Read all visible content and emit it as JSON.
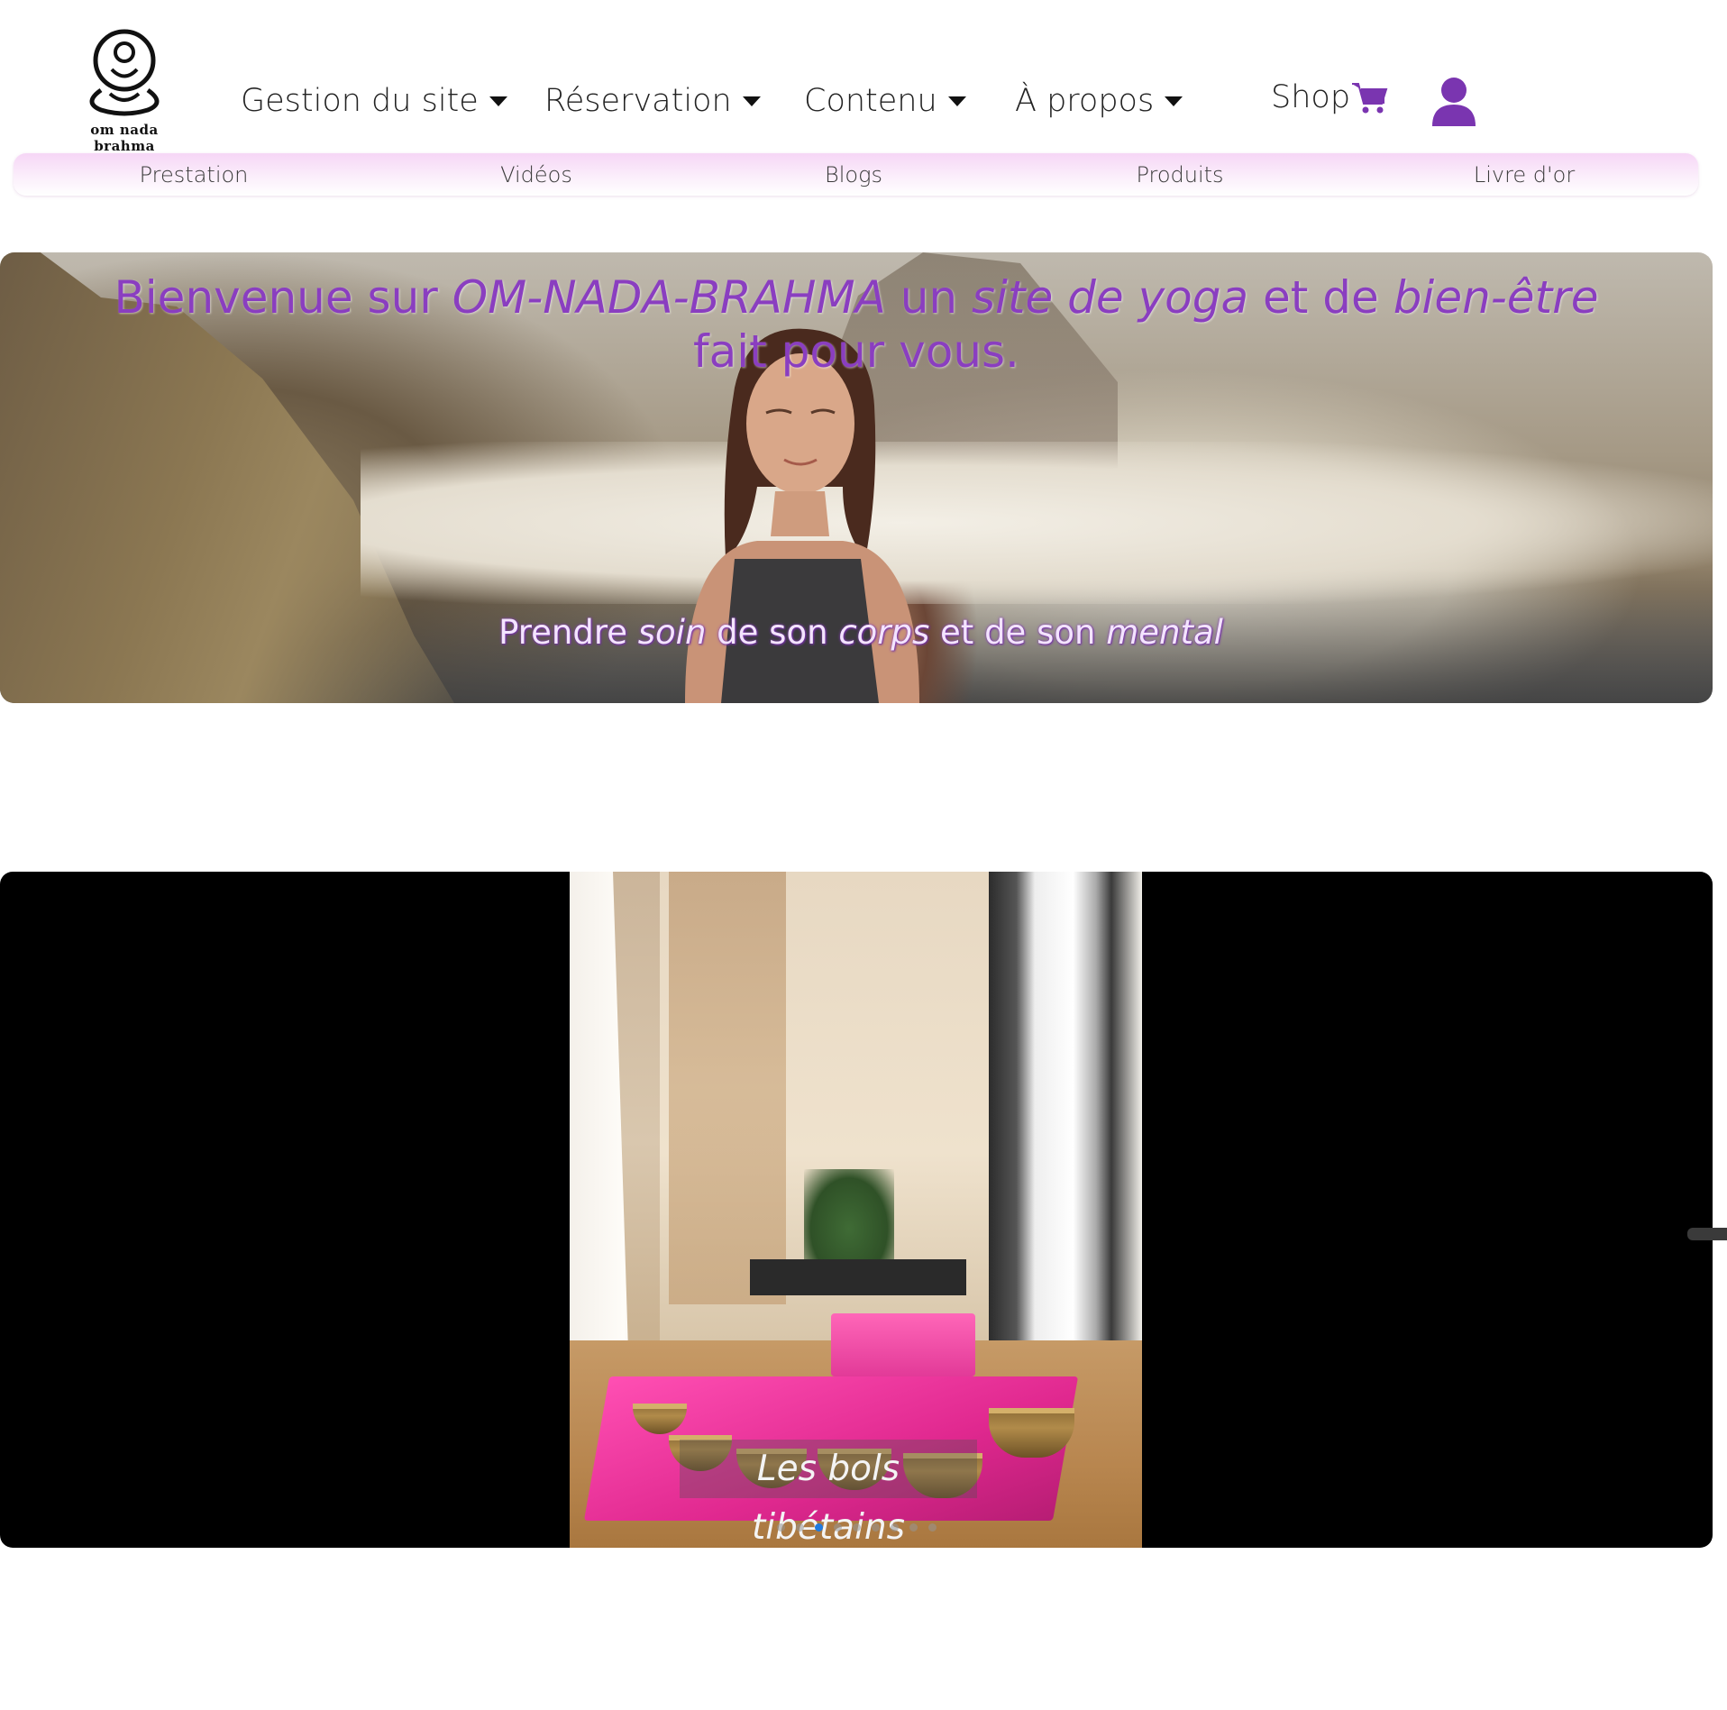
{
  "brand": {
    "logo_text": "om nada brahma"
  },
  "nav": {
    "items": [
      {
        "label": "Gestion du site"
      },
      {
        "label": "Réservation"
      },
      {
        "label": "Contenu"
      },
      {
        "label": "À propos"
      }
    ],
    "shop_label": "Shop",
    "cart_icon": "cart-icon",
    "user_icon": "user-icon"
  },
  "subnav": {
    "items": [
      {
        "label": "Prestation"
      },
      {
        "label": "Vidéos"
      },
      {
        "label": "Blogs"
      },
      {
        "label": "Produits"
      },
      {
        "label": "Livre d'or"
      }
    ]
  },
  "hero": {
    "title_parts": [
      "Bienvenue sur ",
      "OM-NADA-BRAHMA",
      " un ",
      "site de yoga",
      " et de ",
      "bien-être",
      " fait pour vous."
    ],
    "sub_parts": [
      "Prendre ",
      "soin",
      " de son ",
      "corps",
      " et de son ",
      "mental"
    ]
  },
  "carousel": {
    "caption": "Les bols tibétains",
    "slide_count": 9,
    "active_index": 2
  },
  "colors": {
    "accent": "#8a3ec0",
    "subnav_bg": "#f6d6f6",
    "indicator_active": "#1e7ae0"
  }
}
